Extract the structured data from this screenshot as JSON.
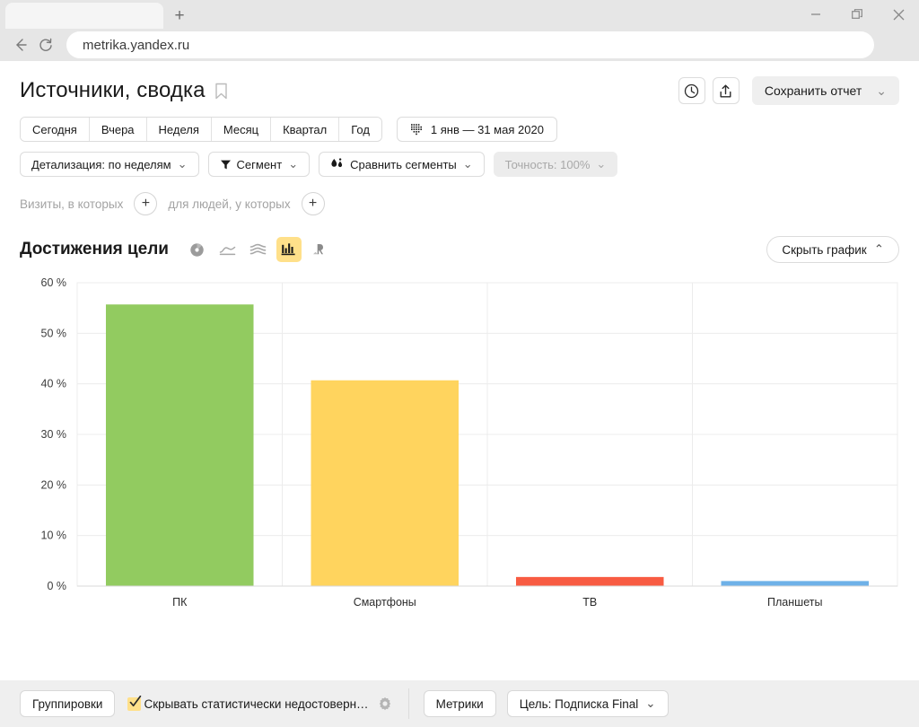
{
  "browser": {
    "url": "metrika.yandex.ru",
    "new_tab_label": "+",
    "back_icon": "back-arrow-icon",
    "reload_icon": "reload-icon",
    "minimize_label": "minimize",
    "restore_label": "restore",
    "close_label": "close"
  },
  "header": {
    "title": "Источники, сводка",
    "bookmark_icon": "bookmark-icon",
    "history_icon": "clock-icon",
    "share_icon": "share-icon",
    "save_report_label": "Сохранить отчет",
    "save_report_chevron": "⌄"
  },
  "periods": {
    "items": [
      {
        "label": "Сегодня"
      },
      {
        "label": "Вчера"
      },
      {
        "label": "Неделя"
      },
      {
        "label": "Месяц"
      },
      {
        "label": "Квартал"
      },
      {
        "label": "Год"
      }
    ],
    "date_range": "1 янв — 31 мая 2020",
    "calendar_icon": "calendar-icon"
  },
  "filters": {
    "detail": {
      "label": "Детализация: по неделям",
      "chevron": "⌄"
    },
    "segment": {
      "label": "Сегмент",
      "chevron": "⌄",
      "icon": "funnel-icon"
    },
    "compare": {
      "label": "Сравнить сегменты",
      "chevron": "⌄",
      "icon": "compare-drops-icon"
    },
    "accuracy": {
      "label": "Точность: 100%",
      "chevron": "⌄",
      "disabled": true
    }
  },
  "visits": {
    "left_label": "Визиты, в которых",
    "right_label": "для людей, у которых",
    "add_label": "+"
  },
  "chart_header": {
    "title": "Достижения цели",
    "viz_icons": [
      {
        "name": "pie-chart-icon",
        "active": false
      },
      {
        "name": "line-chart-icon",
        "active": false
      },
      {
        "name": "area-chart-icon",
        "active": false
      },
      {
        "name": "bar-chart-icon",
        "active": true
      },
      {
        "name": "yandex-map-icon",
        "active": false
      }
    ],
    "hide_label": "Скрыть график",
    "hide_chevron": "⌃"
  },
  "footer": {
    "groupings_label": "Группировки",
    "checkbox_label": "Скрывать статистически недостоверн…",
    "checkbox_checked": true,
    "gear_icon": "gear-icon",
    "metrics_label": "Метрики",
    "goal_label": "Цель: Подписка Final",
    "goal_chevron": "⌄"
  },
  "chart_data": {
    "type": "bar",
    "title": "Достижения цели",
    "xlabel": "",
    "ylabel": "",
    "categories": [
      "ПК",
      "Смартфоны",
      "ТВ",
      "Планшеты"
    ],
    "values": [
      55.7,
      40.7,
      1.8,
      1.0
    ],
    "colors": [
      "#92cb60",
      "#ffd45e",
      "#f85b42",
      "#6eb1e8"
    ],
    "ylim": [
      0,
      60
    ],
    "ytick_values": [
      0,
      10,
      20,
      30,
      40,
      50,
      60
    ],
    "ytick_labels": [
      "0 %",
      "10 %",
      "20 %",
      "30 %",
      "40 %",
      "50 %",
      "60 %"
    ],
    "grid": true,
    "grid_color": "#ececec",
    "legend": "none",
    "plot_bg": "#ffffff"
  }
}
